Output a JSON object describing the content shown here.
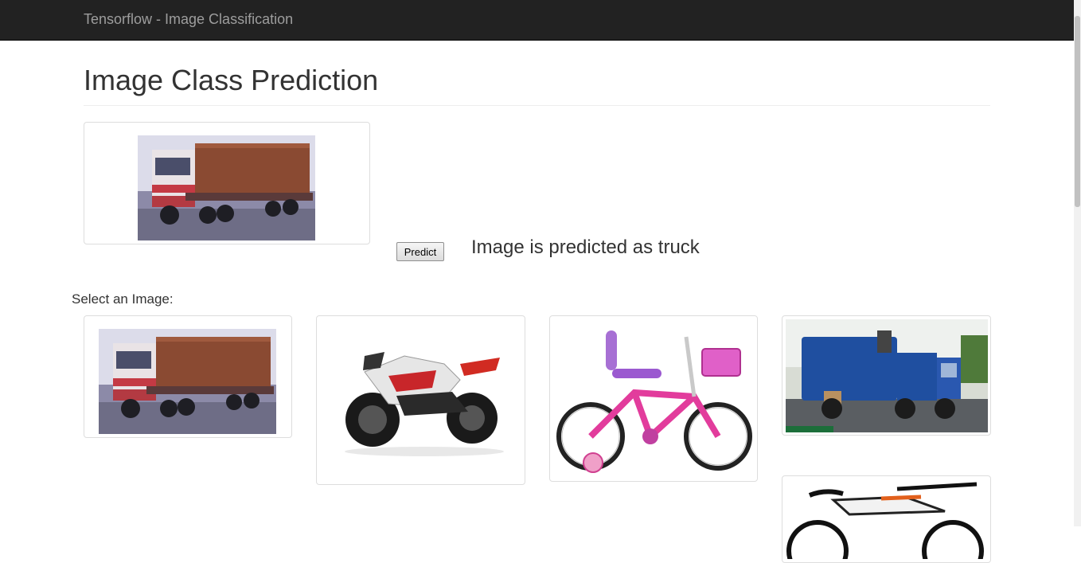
{
  "navbar": {
    "brand": "Tensorflow - Image Classification"
  },
  "page": {
    "title": "Image Class Prediction"
  },
  "preview": {
    "image_name": "truck-photo"
  },
  "predict_button": {
    "label": "Predict"
  },
  "result": {
    "text": "Image is predicted as truck"
  },
  "gallery": {
    "label": "Select an Image:",
    "items": [
      {
        "name": "truck-photo"
      },
      {
        "name": "motorcycle-photo"
      },
      {
        "name": "pink-bicycle-photo"
      },
      {
        "name": "garbage-truck-photo"
      },
      {
        "name": "mountain-bike-photo"
      }
    ]
  },
  "colors": {
    "navbar": "#222222",
    "brand": "#9d9d9d",
    "border": "#dddddd"
  }
}
